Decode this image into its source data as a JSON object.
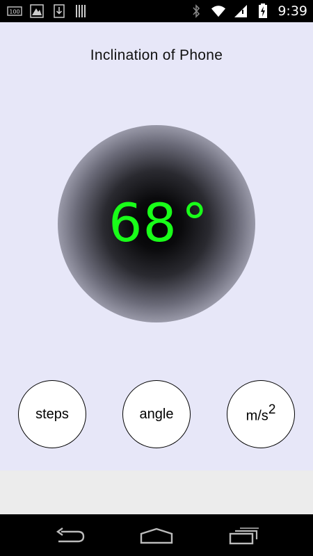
{
  "status_bar": {
    "battery_label": "100",
    "time": "9:39",
    "icons": [
      "battery-100-icon",
      "gallery-icon",
      "download-icon",
      "barcode-icon",
      "bluetooth-icon",
      "wifi-icon",
      "signal-icon",
      "battery-charging-icon"
    ]
  },
  "app": {
    "title": "Inclination of Phone",
    "angle_value": "68",
    "angle_unit": "°",
    "value_color": "#19ff19",
    "background_color": "#e7e7f8"
  },
  "buttons": {
    "steps": "steps",
    "angle": "angle",
    "ms2_base": "m/s",
    "ms2_exp": "2"
  },
  "nav": {
    "icons": [
      "back-icon",
      "home-icon",
      "recent-apps-icon"
    ]
  }
}
